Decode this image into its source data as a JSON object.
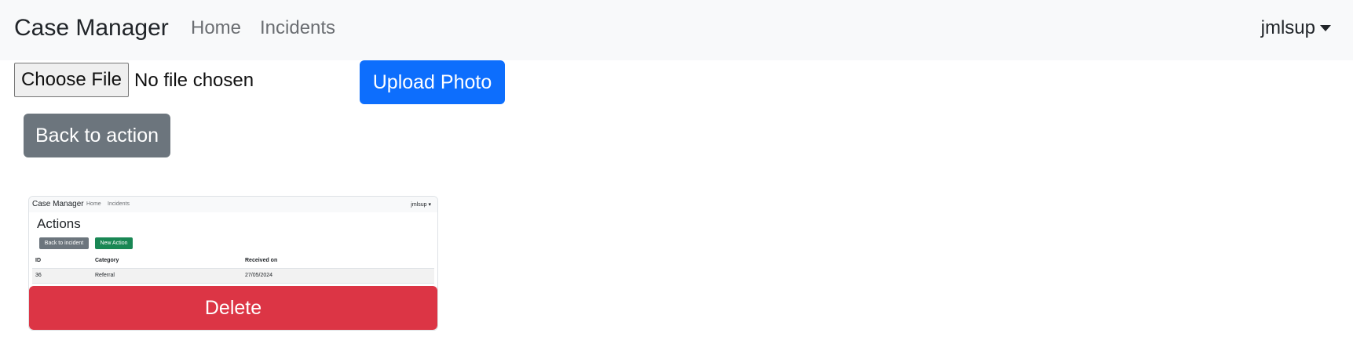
{
  "navbar": {
    "brand": "Case Manager",
    "links": [
      {
        "label": "Home"
      },
      {
        "label": "Incidents"
      }
    ],
    "user": "jmlsup"
  },
  "upload": {
    "file_button_label": "Choose File",
    "file_status": "No file chosen",
    "upload_button_label": "Upload Photo"
  },
  "back_button_label": "Back to action",
  "photo": {
    "thumbnail": {
      "brand": "Case Manager",
      "links": [
        "Home",
        "Incidents"
      ],
      "user": "jmlsup",
      "title": "Actions",
      "back_button": "Back to incident",
      "new_button": "New Action",
      "table": {
        "headers": [
          "ID",
          "Category",
          "Received on"
        ],
        "rows": [
          [
            "36",
            "Referral",
            "27/05/2024"
          ]
        ]
      }
    },
    "delete_button_label": "Delete"
  },
  "colors": {
    "primary": "#0d6efd",
    "secondary": "#6c757d",
    "danger": "#dc3545",
    "success": "#198754",
    "navbar_bg": "#f8f9fa"
  }
}
